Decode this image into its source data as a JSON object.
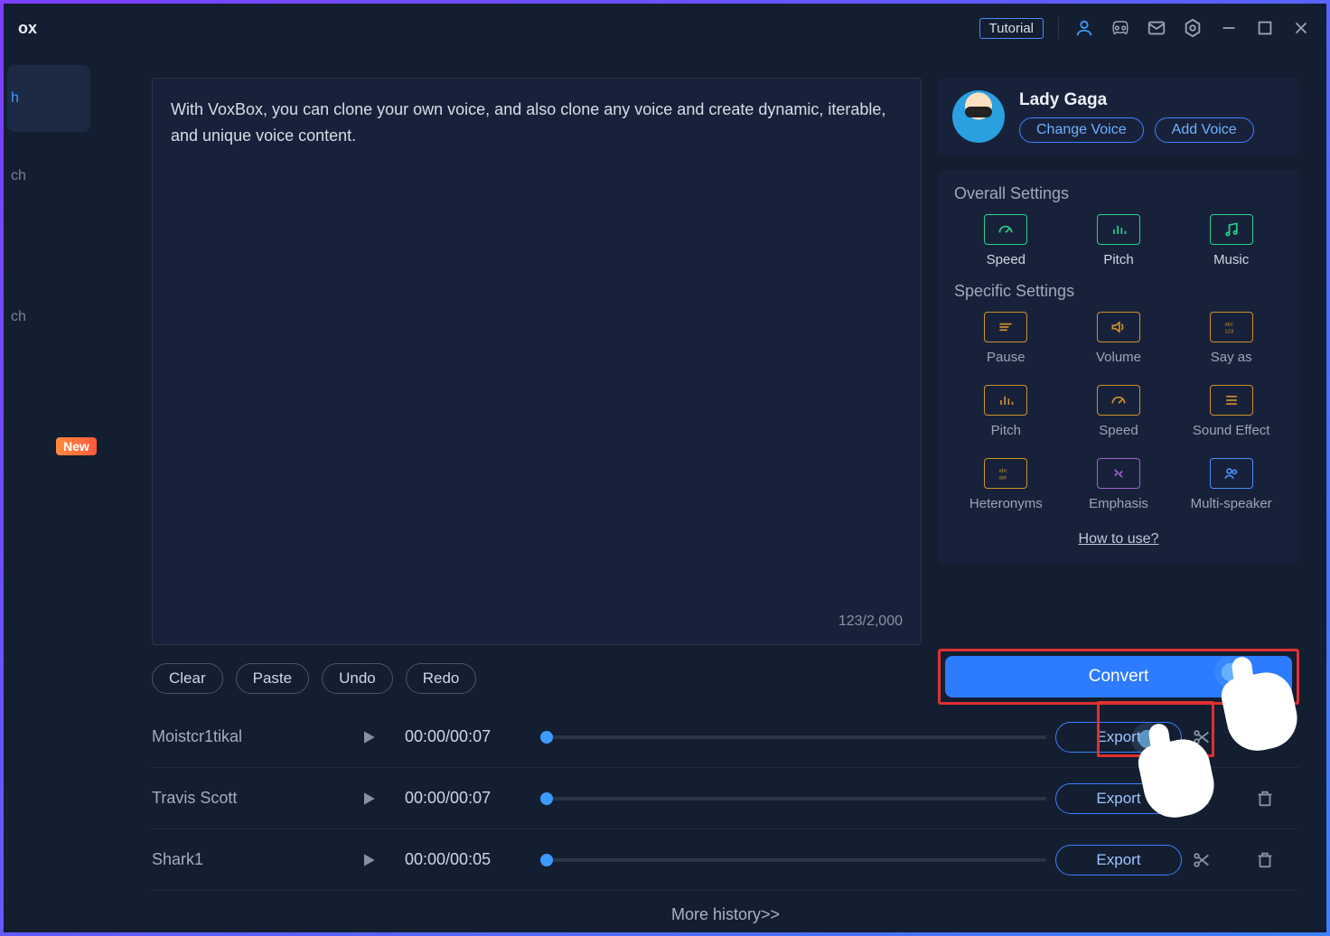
{
  "titlebar": {
    "app_name_partial": "ox",
    "tutorial_label": "Tutorial"
  },
  "sidebar": {
    "items": [
      {
        "label_partial": "h"
      },
      {
        "label_partial": "ch"
      },
      {
        "label_partial": "ch"
      }
    ],
    "new_badge": "New"
  },
  "editor": {
    "text": "With VoxBox, you can clone your own voice, and also clone any voice and create dynamic, iterable, and unique voice content.",
    "char_count": "123/2,000",
    "buttons": {
      "clear": "Clear",
      "paste": "Paste",
      "undo": "Undo",
      "redo": "Redo"
    }
  },
  "voice_panel": {
    "name": "Lady Gaga",
    "change_voice": "Change Voice",
    "add_voice": "Add Voice"
  },
  "settings": {
    "overall_title": "Overall Settings",
    "overall": [
      {
        "label": "Speed",
        "color": "green",
        "icon": "gauge"
      },
      {
        "label": "Pitch",
        "color": "green",
        "icon": "bars"
      },
      {
        "label": "Music",
        "color": "green",
        "icon": "music"
      }
    ],
    "specific_title": "Specific Settings",
    "specific": [
      {
        "label": "Pause",
        "color": "orange",
        "icon": "lines"
      },
      {
        "label": "Volume",
        "color": "orange",
        "icon": "volume"
      },
      {
        "label": "Say as",
        "color": "orange",
        "icon": "abc123"
      },
      {
        "label": "Pitch",
        "color": "orange",
        "icon": "bars"
      },
      {
        "label": "Speed",
        "color": "orange",
        "icon": "gauge"
      },
      {
        "label": "Sound Effect",
        "color": "orange",
        "icon": "menu"
      },
      {
        "label": "Heteronyms",
        "color": "orange",
        "icon": "abcdef"
      },
      {
        "label": "Emphasis",
        "color": "purple",
        "icon": "arrows"
      },
      {
        "label": "Multi-speaker",
        "color": "blue",
        "icon": "users"
      }
    ],
    "how_to_use": "How to use?"
  },
  "convert_label": "Convert",
  "history": {
    "rows": [
      {
        "name": "Moistcr1tikal",
        "time": "00:00/00:07",
        "export": "Export"
      },
      {
        "name": "Travis Scott",
        "time": "00:00/00:07",
        "export": "Export"
      },
      {
        "name": "Shark1",
        "time": "00:00/00:05",
        "export": "Export"
      }
    ],
    "more": "More history>>"
  }
}
